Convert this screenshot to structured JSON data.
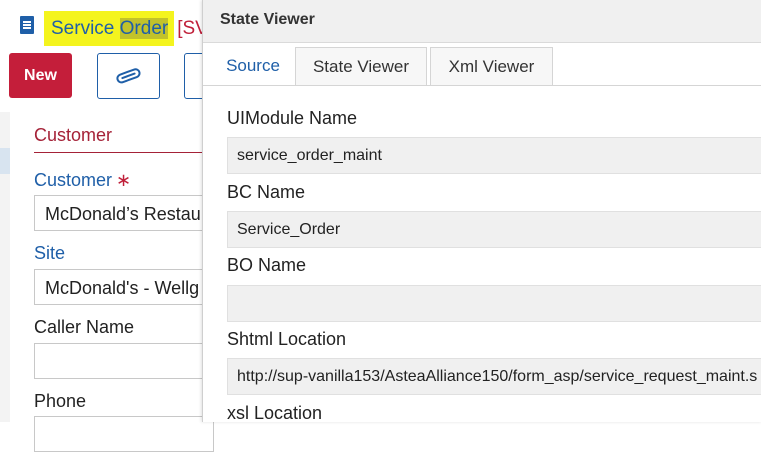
{
  "header": {
    "title_word1": "Service",
    "title_word2": "Order",
    "title_rest": "[SV",
    "new_button": "New"
  },
  "form": {
    "section_title": "Customer",
    "customer_label": "Customer",
    "required_mark": "∗",
    "customer_value": "McDonald’s Restau",
    "site_label": "Site",
    "site_value": "McDonald's - Wellg",
    "caller_label": "Caller Name",
    "caller_value": "",
    "phone_label": "Phone"
  },
  "state_viewer": {
    "title": "State Viewer",
    "tabs": [
      "Source",
      "State Viewer",
      "Xml Viewer"
    ],
    "active_tab": "Source",
    "fields": [
      {
        "label": "UIModule Name",
        "value": "service_order_maint"
      },
      {
        "label": "BC Name",
        "value": "Service_Order"
      },
      {
        "label": "BO Name",
        "value": ""
      },
      {
        "label": "Shtml Location",
        "value": "http://sup-vanilla153/AsteaAlliance150/form_asp/service_request_maint.s"
      },
      {
        "label": "xsl Location",
        "value": ""
      }
    ]
  },
  "icons": {
    "menu": "menu-list-icon",
    "attach": "paperclip-icon"
  },
  "colors": {
    "brand_blue": "#1f5fa8",
    "brand_red": "#c41e3a",
    "highlight": "#f4f41e"
  }
}
